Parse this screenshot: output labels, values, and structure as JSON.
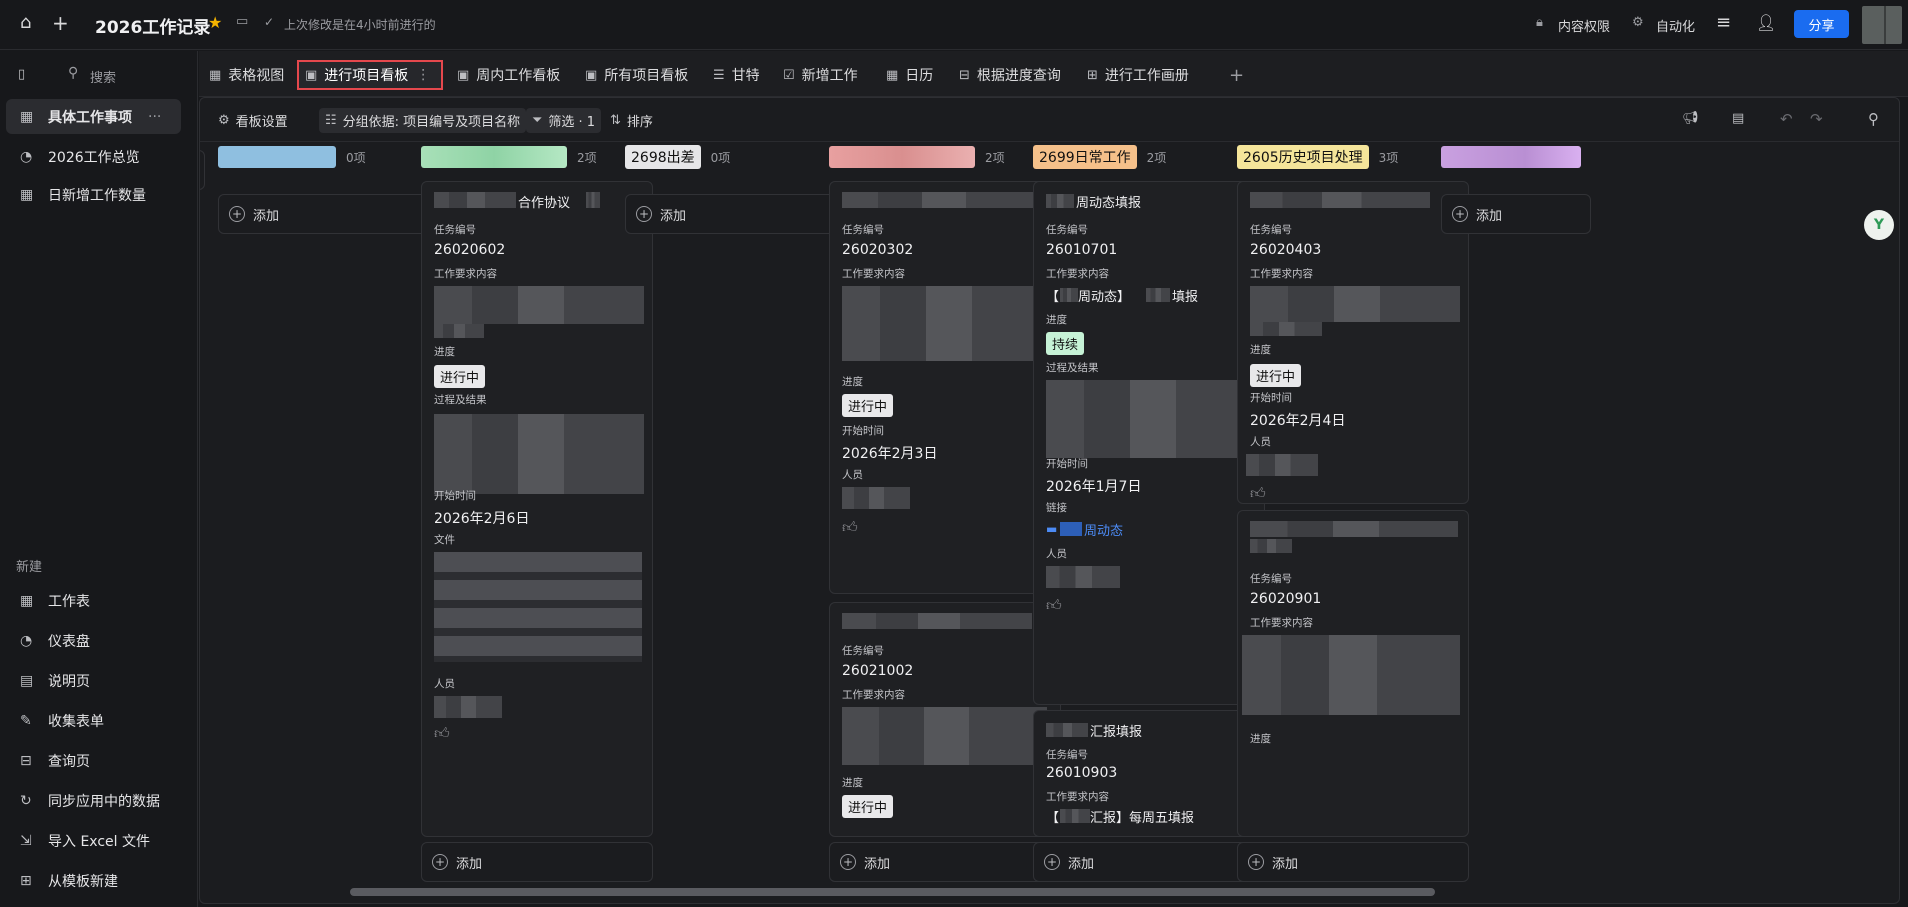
{
  "top": {
    "title": "2026工作记录",
    "last_edit": "上次修改是在4小时前进行的",
    "permissions": "内容权限",
    "automation": "自动化",
    "share": "分享"
  },
  "sidebar": {
    "search": "搜索",
    "items": [
      {
        "label": "具体工作事项",
        "icon": "table-icon"
      },
      {
        "label": "2026工作总览",
        "icon": "dashboard-icon"
      },
      {
        "label": "日新增工作数量",
        "icon": "table-icon"
      }
    ],
    "new_section": "新建",
    "new_items": [
      {
        "label": "工作表",
        "icon": "sheet-icon"
      },
      {
        "label": "仪表盘",
        "icon": "dashboard-icon"
      },
      {
        "label": "说明页",
        "icon": "doc-icon"
      },
      {
        "label": "收集表单",
        "icon": "form-icon"
      },
      {
        "label": "查询页",
        "icon": "query-icon"
      },
      {
        "label": "同步应用中的数据",
        "icon": "sync-icon"
      },
      {
        "label": "导入 Excel 文件",
        "icon": "import-icon"
      },
      {
        "label": "从模板新建",
        "icon": "template-icon"
      }
    ]
  },
  "tabs": [
    "表格视图",
    "进行项目看板",
    "周内工作看板",
    "所有项目看板",
    "甘特",
    "新增工作",
    "日历",
    "根据进度查询",
    "进行工作画册"
  ],
  "toolbar": {
    "settings": "看板设置",
    "group_by": "分组依据: 项目编号及项目名称",
    "filter": "筛选 · 1",
    "sort": "排序"
  },
  "common": {
    "add": "添加",
    "task_no": "任务编号",
    "requirement": "工作要求内容",
    "progress": "进度",
    "process": "过程及结果",
    "start": "开始时间",
    "file": "文件",
    "people": "人员",
    "link": "链接"
  },
  "columns": [
    {
      "name": "",
      "count": "0项",
      "color": "#8fbfe0"
    },
    {
      "name": "",
      "count": "2项",
      "color": "#a8e0b8"
    },
    {
      "name": "2698出差",
      "count": "0项",
      "color": "#e6e6e8"
    },
    {
      "name": "",
      "count": "2项",
      "color": "#e8a0a0"
    },
    {
      "name": "2699日常工作",
      "count": "2项",
      "color": "#f5c08a"
    },
    {
      "name": "2605历史项目处理",
      "count": "3项",
      "color": "#f5e59a"
    },
    {
      "name": "",
      "count": "",
      "color": "#c9a0e0"
    }
  ],
  "cards": {
    "c1": {
      "title": "合作协议",
      "task_no": "26020602",
      "status": "进行中",
      "start": "2026年2月6日"
    },
    "c2": {
      "task_no": "26020302",
      "status": "进行中",
      "start": "2026年2月3日"
    },
    "c3": {
      "task_no": "26021002",
      "status": "进行中"
    },
    "c4": {
      "title": "周动态填报",
      "task_no": "26010701",
      "req_a": "【",
      "req_b": "周动态】",
      "req_c": "填报",
      "status": "持续",
      "start": "2026年1月7日",
      "link": "周动态"
    },
    "c5": {
      "title": "汇报填报",
      "task_no": "26010903",
      "req_a": "【",
      "req_b": "汇报】每周五填报"
    },
    "c6": {
      "task_no": "26020403",
      "status": "进行中",
      "start": "2026年2月4日"
    },
    "c7": {
      "task_no": "26020901"
    }
  }
}
